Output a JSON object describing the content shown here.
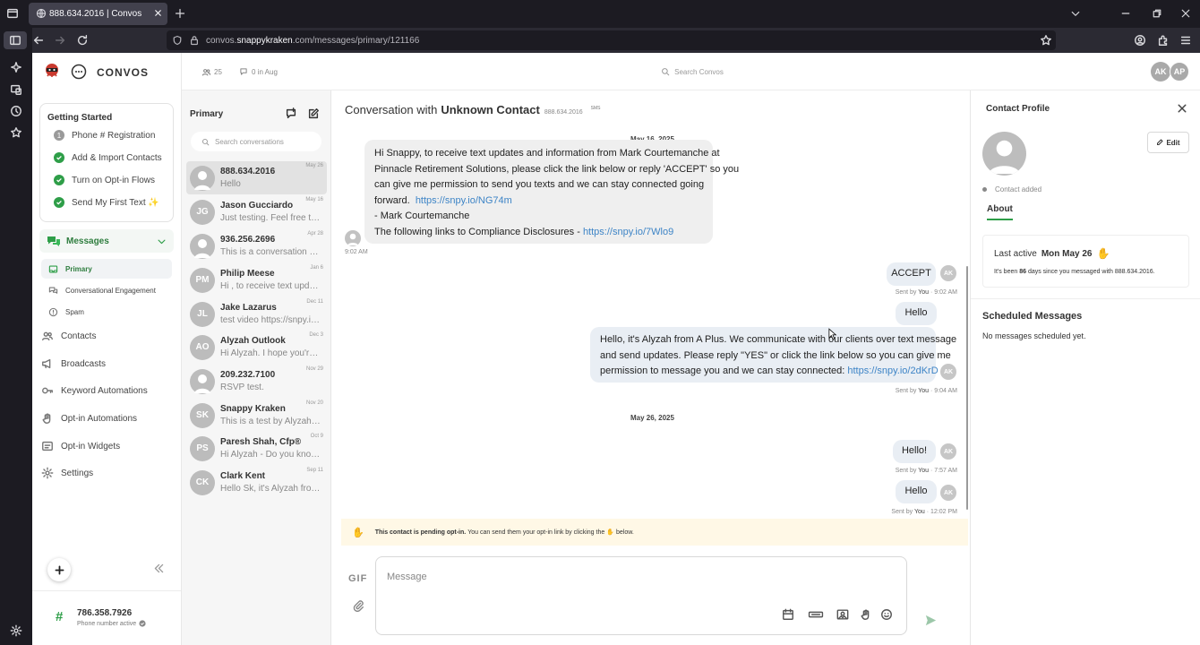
{
  "browser": {
    "tab_title": "888.634.2016 | Convos",
    "url_prefix": "convos.",
    "url_domain": "snappykraken",
    "url_path": ".com/messages/primary/121166"
  },
  "brand": {
    "name": "CONVOS"
  },
  "topbar": {
    "contacts_count": "25",
    "messages_count": "0 in Aug",
    "search_placeholder": "Search Convos",
    "user_avatars": [
      "AK",
      "AP"
    ]
  },
  "getting_started": {
    "title": "Getting Started",
    "items": [
      {
        "label": "Phone # Registration",
        "num": "1"
      },
      {
        "label": "Add & Import Contacts"
      },
      {
        "label": "Turn on Opt-in Flows"
      },
      {
        "label": "Send My First Text ✨"
      }
    ]
  },
  "nav": {
    "messages": "Messages",
    "primary": "Primary",
    "conversational": "Conversational Engagement",
    "spam": "Spam",
    "contacts": "Contacts",
    "broadcasts": "Broadcasts",
    "keyword": "Keyword Automations",
    "optin_auto": "Opt-in Automations",
    "optin_widgets": "Opt-in Widgets",
    "settings": "Settings"
  },
  "phone": {
    "number": "786.358.7926",
    "status": "Phone number active"
  },
  "convlist": {
    "title": "Primary",
    "search_placeholder": "Search conversations",
    "items": [
      {
        "initials": "",
        "name": "888.634.2016",
        "preview": "Hello",
        "date": "May 26"
      },
      {
        "initials": "JG",
        "name": "Jason Gucciardo",
        "preview": "Just testing. Feel free to i...",
        "date": "May 16"
      },
      {
        "initials": "",
        "name": "936.256.2696",
        "preview": "This is a conversation wit...",
        "date": "Apr 28"
      },
      {
        "initials": "PM",
        "name": "Philip Meese",
        "preview": "Hi , to receive text update...",
        "date": "Jan 6"
      },
      {
        "initials": "JL",
        "name": "Jake Lazarus",
        "preview": "test video https://snpy.io/...",
        "date": "Dec 11"
      },
      {
        "initials": "AO",
        "name": "Alyzah Outlook",
        "preview": "Hi Alyzah. I hope you're h...",
        "date": "Dec 3"
      },
      {
        "initials": "",
        "name": "209.232.7100",
        "preview": "RSVP test.",
        "date": "Nov 29"
      },
      {
        "initials": "SK",
        "name": "Snappy Kraken",
        "preview": "This is a test by Alyzah. Pl...",
        "date": "Nov 20"
      },
      {
        "initials": "PS",
        "name": "Paresh Shah, Cfp®",
        "preview": "Hi Alyzah - Do you know ...",
        "date": "Oct 9"
      },
      {
        "initials": "CK",
        "name": "Clark Kent",
        "preview": "Hello Sk, it's Alyzah from ...",
        "date": "Sep 11"
      }
    ]
  },
  "chat": {
    "header_prefix": "Conversation with",
    "contact_name": "Unknown Contact",
    "contact_number": "888.634.2016",
    "channel": "SMS",
    "date1": "May 16, 2025",
    "msg1_l1": "Hi  Snappy, to receive text updates and information from Mark Courtemanche at",
    "msg1_l2": "Pinnacle Retirement Solutions, please click the link below or reply 'ACCEPT' so you",
    "msg1_l3": "can give me permission to send you texts and we can stay connected going",
    "msg1_l4a": "forward.",
    "msg1_link1": "https://snpy.io/NG74m",
    "msg1_l5": "- Mark Courtemanche",
    "msg1_l6a": "The following links to Compliance Disclosures - ",
    "msg1_link2": "https://snpy.io/7Wlo9",
    "msg1_time": "9:02 AM",
    "msg2": "ACCEPT",
    "msg2_meta_a": "Sent by",
    "msg2_meta_you": "You",
    "msg2_meta_t": "· 9:02 AM",
    "msg3": "Hello",
    "msg4_l1": "Hello, it's Alyzah from A Plus. We communicate with our clients over text message",
    "msg4_l2": "and send updates. Please reply \"YES\" or click the link below so you can give me",
    "msg4_l3a": "permission to message you and we can stay connected: ",
    "msg4_link": "https://snpy.io/2dKrD",
    "msg4_l3b": " .",
    "msg4_meta_t": "· 9:04 AM",
    "date2": "May 26, 2025",
    "msg5": "Hello!",
    "msg5_meta_t": "· 7:57 AM",
    "msg6": "Hello",
    "msg6_meta_t": "· 12:02 PM",
    "avatar": "AK",
    "optin_bold": "This contact is pending opt-in.",
    "optin_rest": " You can send them your opt-in link by clicking the",
    "optin_end": " below.",
    "gif_label": "GIF",
    "composer_placeholder": "Message"
  },
  "profile": {
    "title": "Contact Profile",
    "edit": "Edit",
    "contact_added": "Contact added",
    "about_tab": "About",
    "last_active_label": "Last active",
    "last_active_value": "Mon May 26",
    "since_a": "It's been ",
    "since_days": "86",
    "since_b": " days since you messaged with 888.634.2016.",
    "scheduled_title": "Scheduled Messages",
    "scheduled_empty": "No messages scheduled yet."
  },
  "colors": {
    "accent": "#2e9e48",
    "link": "#3d84c6",
    "chrome": "#1c1b22",
    "banner": "#fff8e6"
  }
}
